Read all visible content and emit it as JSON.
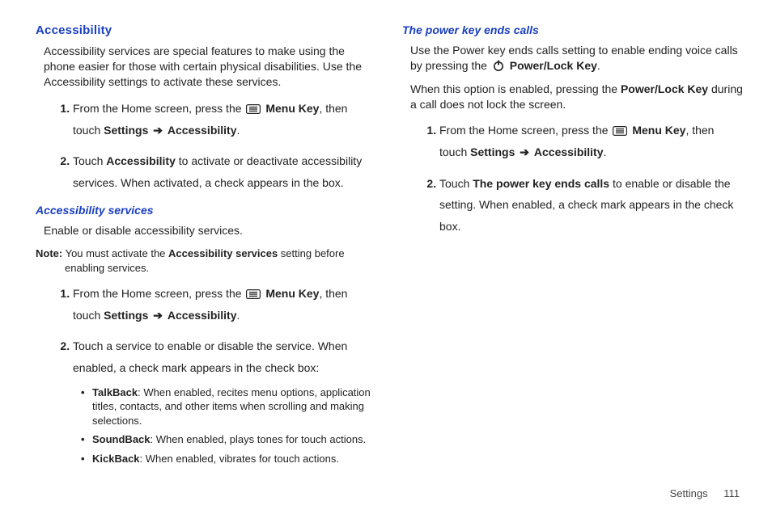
{
  "left": {
    "h2": "Accessibility",
    "intro": "Accessibility services are special features to make using the phone easier for those with certain physical disabilities. Use the Accessibility settings to activate these services.",
    "s1a": "From the Home screen, press the ",
    "menuKey": "Menu Key",
    "s1b": ", then touch ",
    "settings": "Settings",
    "accessibility": "Accessibility",
    "s2a": "Touch ",
    "accessibilityBold": "Accessibility",
    "s2b": " to activate or deactivate accessibility services. When activated, a check appears in the box.",
    "h3a": "Accessibility services",
    "servicesIntro": "Enable or disable accessibility services.",
    "noteLabel": "Note:",
    "noteA": " You must activate the ",
    "noteBold": "Accessibility services",
    "noteB": " setting before enabling services.",
    "s2txt": "Touch a service to enable or disable the service. When enabled, a check mark appears in the check box:",
    "talkback": "TalkBack",
    "talkbackTxt": ": When enabled, recites menu options, application titles, contacts, and other items when scrolling and making selections.",
    "soundback": "SoundBack",
    "soundbackTxt": ": When enabled, plays tones for touch actions.",
    "kickback": "KickBack",
    "kickbackTxt": ": When enabled, vibrates for touch actions."
  },
  "right": {
    "h3": "The power key ends calls",
    "introA": "Use the Power key ends calls setting to enable ending voice calls by pressing the ",
    "powerKey": "Power/Lock Key",
    "introB": ".",
    "p2a": "When this option is enabled, pressing the ",
    "p2b": " during a call does not lock the screen.",
    "s1a": "From the Home screen, press the ",
    "menuKey": "Menu Key",
    "s1b": ", then touch ",
    "settings": "Settings",
    "accessibility": "Accessibility",
    "s2a": "Touch ",
    "powerEndsCalls": "The power key ends calls",
    "s2b": " to enable or disable the setting. When enabled, a check mark appears in the check box."
  },
  "arrow": "➔",
  "period": ".",
  "footer": {
    "label": "Settings",
    "page": "111"
  }
}
